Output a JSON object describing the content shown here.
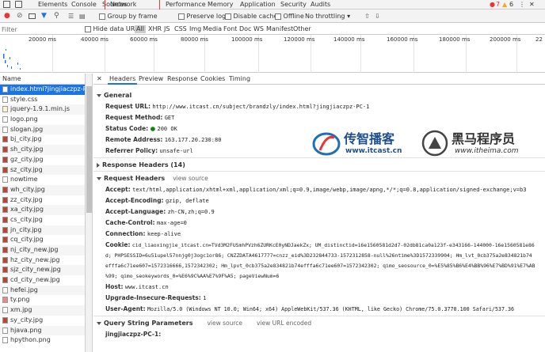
{
  "devtools": {
    "tabs": [
      "Elements",
      "Console",
      "Sources",
      "Network",
      "Performance",
      "Memory",
      "Application",
      "Security",
      "Audits"
    ],
    "active_tab": "Network",
    "error_count": "7",
    "warning_count": "6"
  },
  "toolbar": {
    "group_by_frame": "Group by frame",
    "preserve_log": "Preserve log",
    "disable_cache": "Disable cache",
    "offline": "Offline",
    "throttle": "No throttling"
  },
  "filter": {
    "placeholder": "Filter",
    "hide_data_urls": "Hide data URLs",
    "types": [
      "All",
      "XHR",
      "JS",
      "CSS",
      "Img",
      "Media",
      "Font",
      "Doc",
      "WS",
      "Manifest",
      "Other"
    ]
  },
  "overview": {
    "ticks": [
      "20000 ms",
      "40000 ms",
      "60000 ms",
      "80000 ms",
      "100000 ms",
      "120000 ms",
      "140000 ms",
      "160000 ms",
      "180000 ms",
      "200000 ms",
      "22"
    ]
  },
  "requests": {
    "header": "Name",
    "items": [
      "index.html?jingjiaczpz-PC-1",
      "style.css",
      "jquery-1.9.1.min.js",
      "logo.png",
      "slogan.jpg",
      "bj_city.jpg",
      "sh_city.jpg",
      "gz_city.jpg",
      "sz_city.jpg",
      "nowtime",
      "wh_city.jpg",
      "zz_city.jpg",
      "xa_city.jpg",
      "cs_city.jpg",
      "jn_city.jpg",
      "cq_city.jpg",
      "nj_city_new.jpg",
      "hz_city_new.jpg",
      "sjz_city_new.jpg",
      "cd_city_new.jpg",
      "hefei.jpg",
      "ty.png",
      "xm.jpg",
      "sy_city.jpg",
      "hjava.png",
      "hpython.png"
    ]
  },
  "details": {
    "tabs": [
      "Headers",
      "Preview",
      "Response",
      "Cookies",
      "Timing"
    ],
    "general": {
      "title": "General",
      "request_url_label": "Request URL:",
      "request_url": "http://www.itcast.cn/subject/brandzly/index.html?jingjiaczpz-PC-1",
      "method_label": "Request Method:",
      "method": "GET",
      "status_label": "Status Code:",
      "status": "200 OK",
      "remote_label": "Remote Address:",
      "remote": "163.177.20.230:80",
      "referrer_label": "Referrer Policy:",
      "referrer": "unsafe-url"
    },
    "response_headers": "Response Headers (14)",
    "request_headers": {
      "title": "Request Headers",
      "view_source": "view source",
      "accept_label": "Accept:",
      "accept": "text/html,application/xhtml+xml,application/xml;q=0.9,image/webp,image/apng,*/*;q=0.8,application/signed-exchange;v=b3",
      "encoding_label": "Accept-Encoding:",
      "encoding": "gzip, deflate",
      "language_label": "Accept-Language:",
      "language": "zh-CN,zh;q=0.9",
      "cache_label": "Cache-Control:",
      "cache": "max-age=0",
      "connection_label": "Connection:",
      "connection": "keep-alive",
      "cookie_label": "Cookie:",
      "cookie_1": "cid_liaoxingjie_itcast.cn=TVd3M2FUSmhPVzh6ZURKcE0yNDJaekZx; UM_distinctid=16e1560581d2d7-02db81ca0a123f-e343166-144000-16e1560581e86",
      "cookie_2": "d; PHPSESSID=6u51upel57nnjg0j3ogc1or86; CNZZDATA4617777=cnzz_eid%3D232844733-1572312858-null%26ntime%3D1572339904; Hm_lvt_0cb375a2e834821b74",
      "cookie_3": "efffa6c71ee607=1572316666,1572342302; Hm_lpvt_0cb375a2e834821b74efffa6c71ee607=1572342302; qimo_seosource_0=%E5%85%B6%E4%BB%96%E7%BD%91%E7%AB",
      "cookie_4": "%99; qimo_seokeywords_0=%E6%9C%AA%E7%9F%A5; pageViewNum=6",
      "host_label": "Host:",
      "host": "www.itcast.cn",
      "upgrade_label": "Upgrade-Insecure-Requests:",
      "upgrade": "1",
      "ua_label": "User-Agent:",
      "ua": "Mozilla/5.0 (Windows NT 10.0; Win64; x64) AppleWebKit/537.36 (KHTML, like Gecko) Chrome/75.0.3770.100 Safari/537.36"
    },
    "query": {
      "title": "Query String Parameters",
      "view_source": "view source",
      "view_url_encoded": "view URL encoded",
      "param": "jingjiaczpz-PC-1:"
    }
  },
  "watermark": {
    "brand1": "传智播客",
    "brand1_url": "www.itcast.cn",
    "brand2": "黑马程序员",
    "brand2_url": "www.itheima.com"
  },
  "colors": {
    "accent": "#1a73e8",
    "error": "#e33",
    "warning": "#f5a623",
    "status_ok": "#0a8a0a"
  }
}
